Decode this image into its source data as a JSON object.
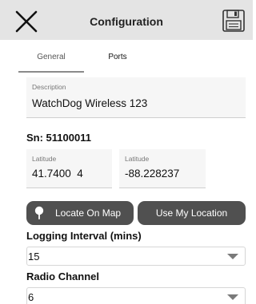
{
  "header": {
    "title": "Configuration",
    "close_icon": "close-x-icon",
    "save_icon": "floppy-disk-icon",
    "background": "#e4e4e4"
  },
  "tabs": [
    {
      "label": "General",
      "active": true
    },
    {
      "label": "Ports",
      "active": false
    }
  ],
  "description": {
    "label": "Description",
    "value": "WatchDog Wireless 123"
  },
  "serial": {
    "text": "Sn: 51100011"
  },
  "location": {
    "latitude_1": {
      "label": "Latitude",
      "value": "41.7400  4"
    },
    "latitude_2": {
      "label": "Latitude",
      "value": "-88.228237"
    }
  },
  "buttons": {
    "locate_on_map": "Locate On Map",
    "use_my_location": "Use My Location",
    "button_color": "#505050"
  },
  "logging_interval": {
    "label": "Logging Interval (mins)",
    "value": "15"
  },
  "radio_channel": {
    "label": "Radio Channel",
    "value": "6"
  }
}
